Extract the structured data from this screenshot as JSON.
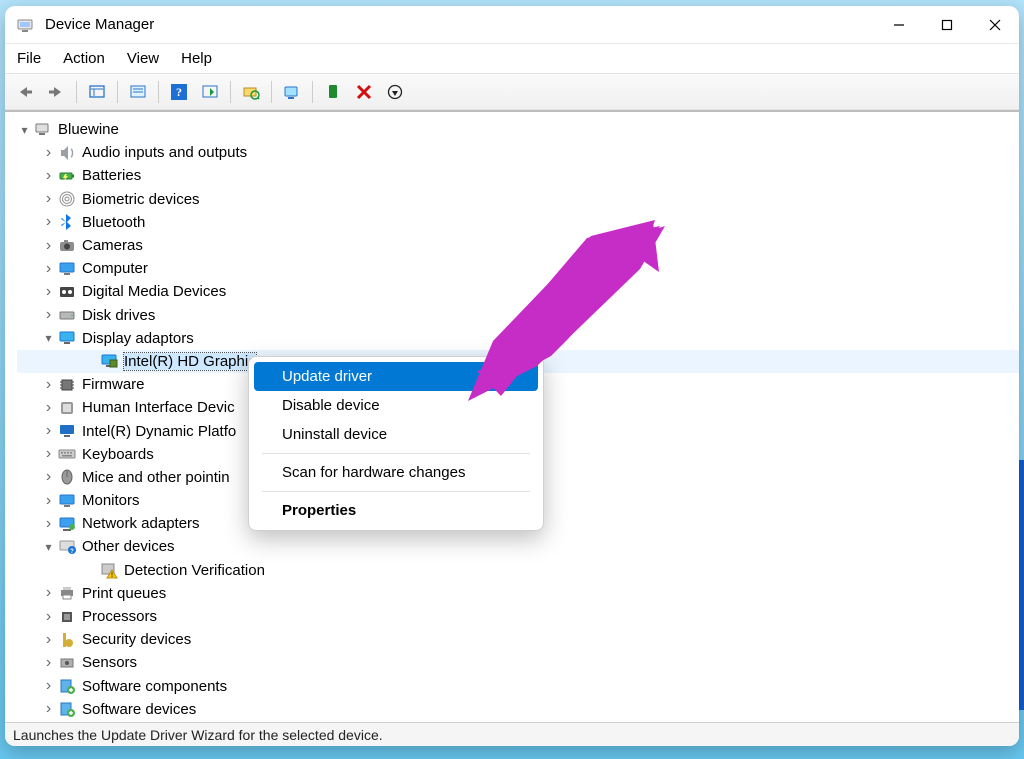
{
  "window": {
    "title": "Device Manager"
  },
  "menubar": [
    "File",
    "Action",
    "View",
    "Help"
  ],
  "tree": {
    "root": "Bluewine",
    "nodes": [
      {
        "label": "Audio inputs and outputs",
        "chev": "closed",
        "icon": "audio"
      },
      {
        "label": "Batteries",
        "chev": "closed",
        "icon": "battery"
      },
      {
        "label": "Biometric devices",
        "chev": "closed",
        "icon": "fingerprint"
      },
      {
        "label": "Bluetooth",
        "chev": "closed",
        "icon": "bluetooth"
      },
      {
        "label": "Cameras",
        "chev": "closed",
        "icon": "camera"
      },
      {
        "label": "Computer",
        "chev": "closed",
        "icon": "monitor"
      },
      {
        "label": "Digital Media Devices",
        "chev": "closed",
        "icon": "media"
      },
      {
        "label": "Disk drives",
        "chev": "closed",
        "icon": "drive"
      },
      {
        "label": "Display adaptors",
        "chev": "open",
        "icon": "display",
        "children": [
          {
            "label": "Intel(R) HD Graphic",
            "selected": true,
            "icon": "display-chip"
          }
        ]
      },
      {
        "label": "Firmware",
        "chev": "closed",
        "icon": "chip"
      },
      {
        "label": "Human Interface Devic",
        "chev": "closed",
        "icon": "hid"
      },
      {
        "label": "Intel(R) Dynamic Platfo",
        "chev": "closed",
        "icon": "intel"
      },
      {
        "label": "Keyboards",
        "chev": "closed",
        "icon": "keyboard"
      },
      {
        "label": "Mice and other pointin",
        "chev": "closed",
        "icon": "mouse"
      },
      {
        "label": "Monitors",
        "chev": "closed",
        "icon": "monitor"
      },
      {
        "label": "Network adapters",
        "chev": "closed",
        "icon": "network"
      },
      {
        "label": "Other devices",
        "chev": "open",
        "icon": "other",
        "children": [
          {
            "label": "Detection Verification",
            "icon": "warn"
          }
        ]
      },
      {
        "label": "Print queues",
        "chev": "closed",
        "icon": "printer"
      },
      {
        "label": "Processors",
        "chev": "closed",
        "icon": "cpu"
      },
      {
        "label": "Security devices",
        "chev": "closed",
        "icon": "security"
      },
      {
        "label": "Sensors",
        "chev": "closed",
        "icon": "sensor"
      },
      {
        "label": "Software components",
        "chev": "closed",
        "icon": "software"
      },
      {
        "label": "Software devices",
        "chev": "closed",
        "icon": "software"
      }
    ]
  },
  "context_menu": {
    "items": [
      {
        "label": "Update driver",
        "highlight": true
      },
      {
        "label": "Disable device"
      },
      {
        "label": "Uninstall device"
      },
      {
        "sep": true
      },
      {
        "label": "Scan for hardware changes"
      },
      {
        "sep": true
      },
      {
        "label": "Properties",
        "bold": true
      }
    ]
  },
  "statusbar": "Launches the Update Driver Wizard for the selected device."
}
